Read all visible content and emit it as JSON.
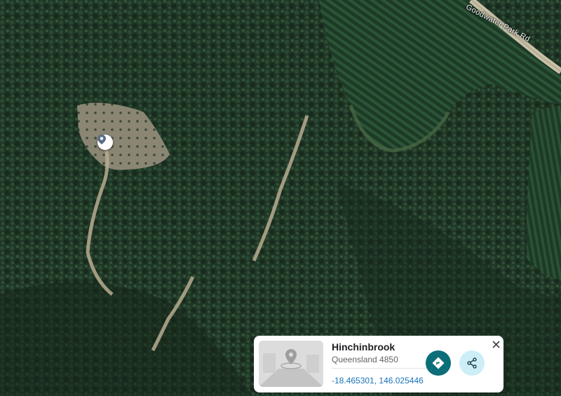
{
  "map": {
    "road_label": "Goodwater Park Rd",
    "colors": {
      "forest": "#1f3625",
      "plantation": "#23452f",
      "clearing": "#8b8674",
      "track": "#b8ad90"
    },
    "marker_icon": "location-pin-icon"
  },
  "place_card": {
    "title": "Hinchinbrook",
    "subtitle": "Queensland 4850",
    "coordinates": "-18.465301, 146.025446",
    "thumbnail_icon": "street-view-placeholder-icon",
    "directions_icon": "directions-icon",
    "share_icon": "share-icon",
    "close_icon": "close-icon",
    "colors": {
      "directions_button": "#0b6e78",
      "share_button": "#cdeef6",
      "coordinates_text": "#1a73b8"
    }
  }
}
